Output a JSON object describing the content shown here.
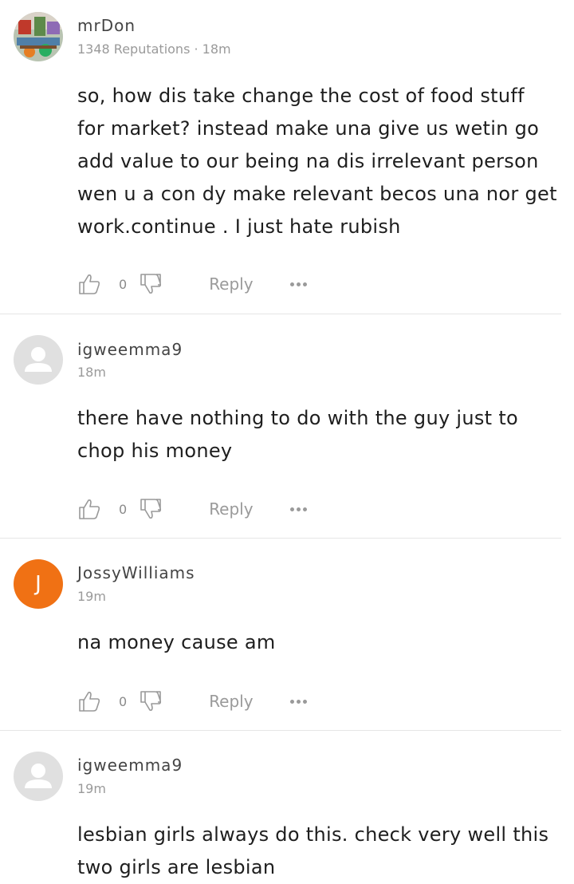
{
  "comments": [
    {
      "username": "mrDon",
      "meta": "1348 Reputations · 18m",
      "avatar": {
        "type": "image",
        "icon": "profile-photo"
      },
      "body_lines": [
        "so, how dis take change the cost of food stuff",
        "for market? instead make una give us wetin go",
        "add value to our being na dis irrelevant person",
        "wen u a con dy make relevant becos una nor get",
        "work.continue . I just hate rubish"
      ],
      "likes": "0",
      "reply_label": "Reply"
    },
    {
      "username": "igweemma9",
      "meta": "18m",
      "avatar": {
        "type": "generic",
        "icon": "user-placeholder"
      },
      "body_lines": [
        "there have nothing to do with the guy just to",
        "chop his money"
      ],
      "likes": "0",
      "reply_label": "Reply"
    },
    {
      "username": "JossyWilliams",
      "meta": "19m",
      "avatar": {
        "type": "letter",
        "letter": "J",
        "color": "#f07114"
      },
      "body_lines": [
        "na money cause am"
      ],
      "likes": "0",
      "reply_label": "Reply"
    },
    {
      "username": "igweemma9",
      "meta": "19m",
      "avatar": {
        "type": "generic",
        "icon": "user-placeholder"
      },
      "body_lines": [
        "lesbian girls always do this. check very well this",
        "two girls are lesbian"
      ],
      "likes": "",
      "reply_label": ""
    }
  ],
  "colors": {
    "accent_avatar": "#f07114",
    "divider": "#e6e6e6",
    "muted_text": "#9a9a9a"
  }
}
